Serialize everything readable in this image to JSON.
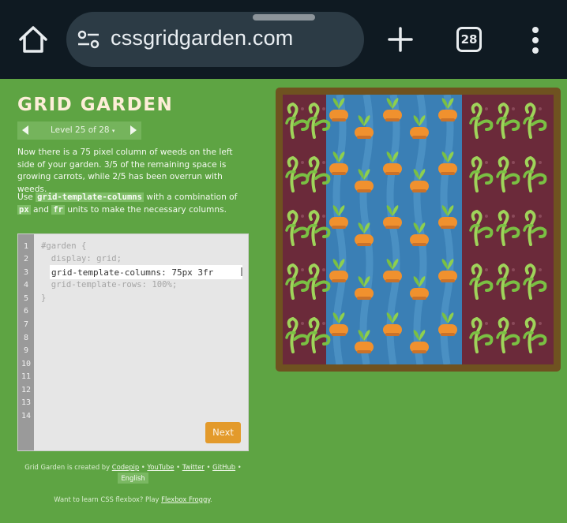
{
  "browser": {
    "url": "cssgridgarden.com",
    "tab_count": "28"
  },
  "game": {
    "title": "GRID GARDEN",
    "level_label": "Level 25 of 28",
    "level_caret": "▾",
    "instructions": {
      "p1": "Now there is a 75 pixel column of weeds on the left side of your garden. 3/5 of the remaining space is growing carrots, while 2/5 has been overrun with weeds.",
      "p2_prefix": "Use ",
      "p2_code1": "grid-template-columns",
      "p2_mid1": " with a combination of ",
      "p2_code2": "px",
      "p2_mid2": " and ",
      "p2_code3": "fr",
      "p2_suffix": " units to make the necessary columns."
    },
    "editor": {
      "line_numbers": [
        "1",
        "2",
        "3",
        "4",
        "5",
        "6",
        "7",
        "8",
        "9",
        "10",
        "11",
        "12",
        "13",
        "14"
      ],
      "line1": "#garden {",
      "line2": "  display: grid;",
      "input_value": "grid-template-columns: 75px 3fr",
      "line4": "  grid-template-rows: 100%;",
      "line5": "}",
      "next_label": "Next"
    },
    "footer": {
      "created_by": "Grid Garden is created by ",
      "codepip": "Codepip",
      "youtube": "YouTube",
      "twitter": "Twitter",
      "github": "GitHub",
      "separator": " • ",
      "language": "English",
      "learn_prefix": "Want to learn CSS flexbox? Play ",
      "flexbox_froggy": "Flexbox Froggy",
      "learn_suffix": "."
    },
    "garden": {
      "weeds_color": "#6b2a3a",
      "water_color": "#3a7fb5",
      "weed_color": "#7ac043",
      "carrot_color": "#f0912e"
    }
  }
}
